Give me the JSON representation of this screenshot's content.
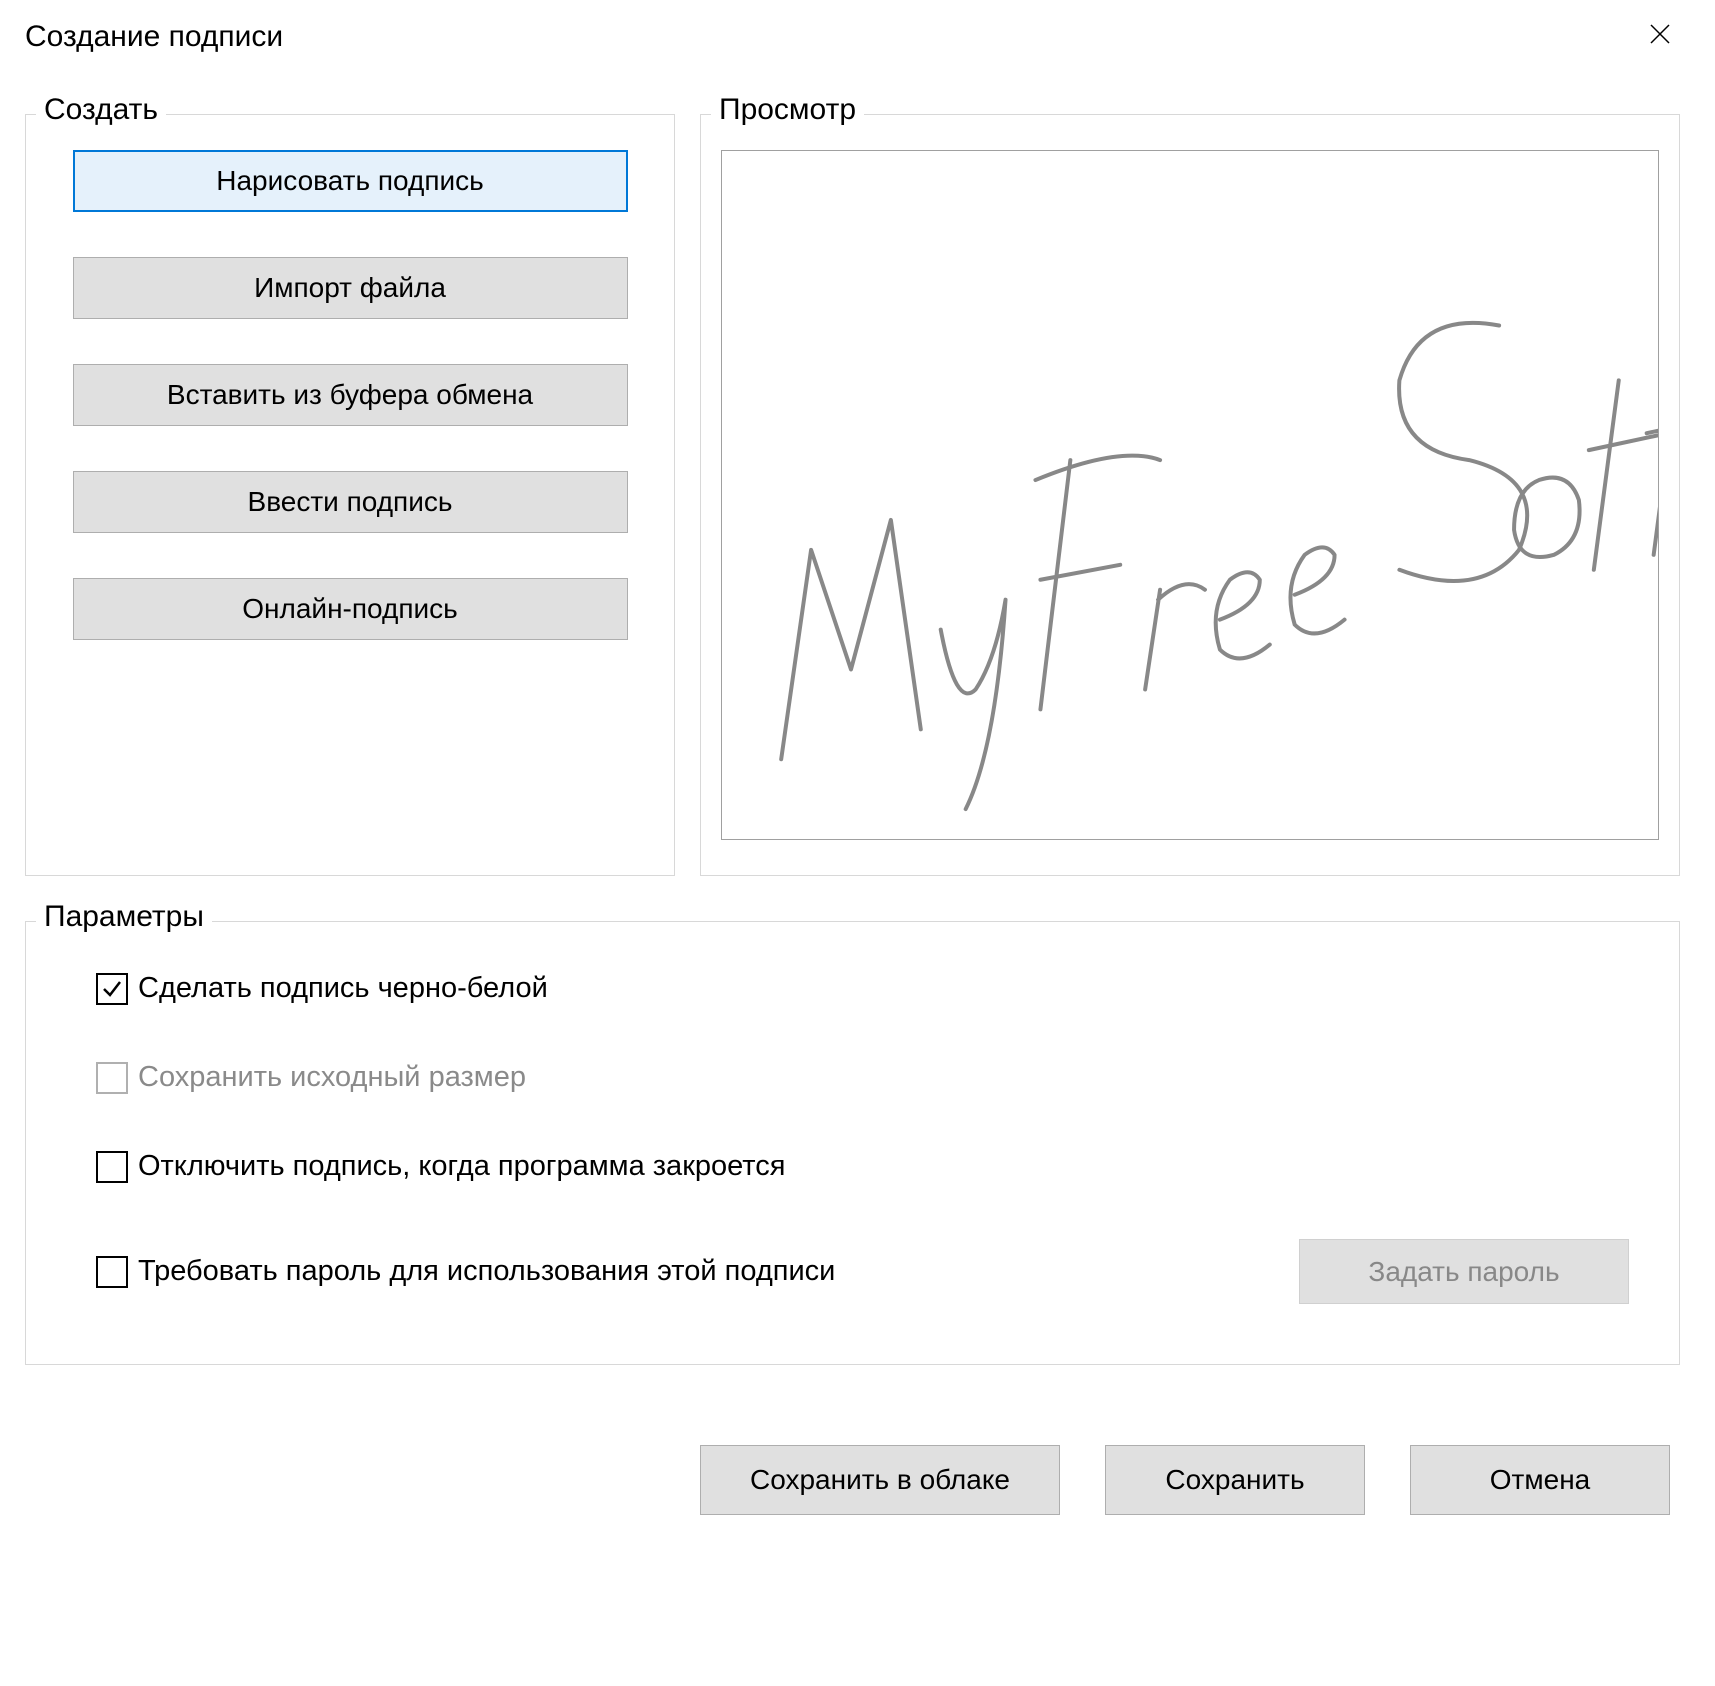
{
  "dialog": {
    "title": "Создание подписи"
  },
  "create": {
    "group_title": "Создать",
    "draw": "Нарисовать подпись",
    "import": "Импорт файла",
    "paste": "Вставить из буфера обмена",
    "type": "Ввести подпись",
    "online": "Онлайн-подпись"
  },
  "preview": {
    "group_title": "Просмотр",
    "signature_text": "My Free Soft"
  },
  "options": {
    "group_title": "Параметры",
    "bw": "Сделать подпись черно-белой",
    "keep_size": "Сохранить исходный размер",
    "discard_on_close": "Отключить подпись, когда программа закроется",
    "require_password": "Требовать пароль для использования этой подписи",
    "set_password": "Задать пароль"
  },
  "footer": {
    "save_cloud": "Сохранить в облаке",
    "save": "Сохранить",
    "cancel": "Отмена"
  }
}
